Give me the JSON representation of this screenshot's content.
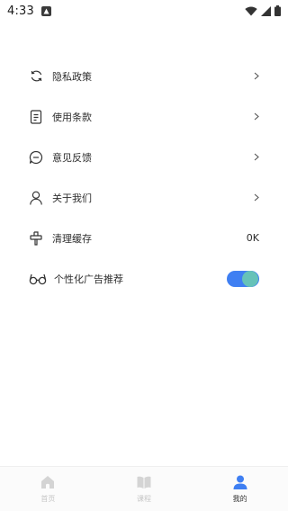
{
  "status_bar": {
    "time": "4:33"
  },
  "menu": {
    "items": [
      {
        "label": "隐私政策",
        "icon": "refresh-icon"
      },
      {
        "label": "使用条款",
        "icon": "document-icon"
      },
      {
        "label": "意见反馈",
        "icon": "chat-icon"
      },
      {
        "label": "关于我们",
        "icon": "person-icon"
      }
    ],
    "cache": {
      "label": "清理缓存",
      "value": "0K",
      "icon": "brush-icon"
    },
    "ad_toggle": {
      "label": "个性化广告推荐",
      "enabled": true,
      "icon": "glasses-icon"
    }
  },
  "tabbar": {
    "tabs": [
      {
        "label": "首页",
        "icon": "home-icon",
        "active": false
      },
      {
        "label": "课程",
        "icon": "book-icon",
        "active": false
      },
      {
        "label": "我的",
        "icon": "user-icon",
        "active": true
      }
    ]
  },
  "colors": {
    "toggle_track": "#3f7ff2",
    "toggle_knob": "#66c2b8",
    "active_tab": "#3f7ff2",
    "inactive_tab": "#d0d0d0"
  }
}
